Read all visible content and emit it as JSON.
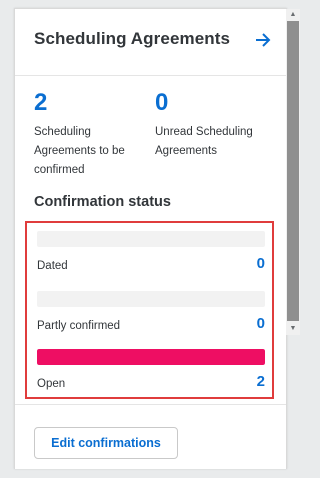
{
  "card": {
    "title": "Scheduling Agreements",
    "nav_icon": "arrow-right-icon"
  },
  "kpis": [
    {
      "value": "2",
      "label": "Scheduling Agreements to be confirmed"
    },
    {
      "value": "0",
      "label": "Unread Scheduling Agreements"
    }
  ],
  "confirmation_status": {
    "title": "Confirmation status",
    "rows": [
      {
        "label": "Dated",
        "count": "0",
        "fill_fraction": 0
      },
      {
        "label": "Partly confirmed",
        "count": "0",
        "fill_fraction": 0
      },
      {
        "label": "Open",
        "count": "2",
        "fill_fraction": 1
      }
    ]
  },
  "footer": {
    "button_label": "Edit confirmations"
  },
  "colors": {
    "accent": "#0a6ed1",
    "bar": "#ee0e63",
    "highlight_border": "#e03c3c"
  }
}
